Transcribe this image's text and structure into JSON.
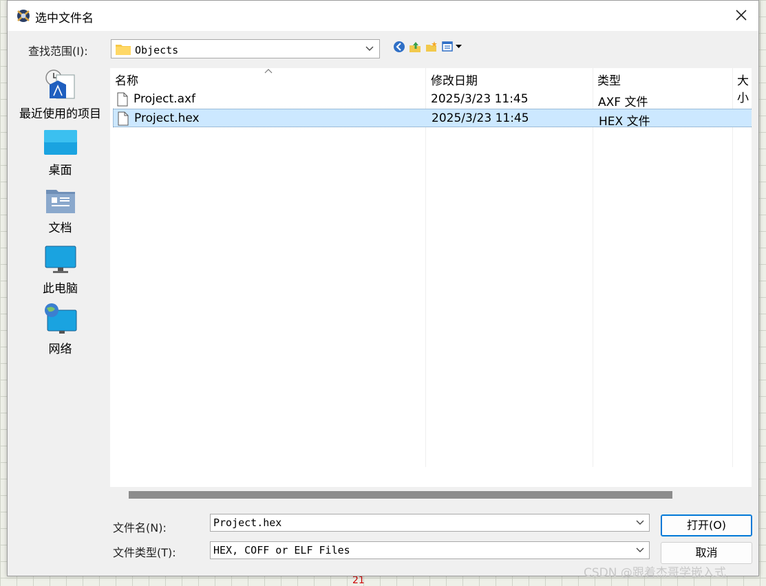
{
  "window": {
    "title": "选中文件名"
  },
  "lookin": {
    "label": "查找范围(I):",
    "value": "Objects"
  },
  "toolbar": {
    "back_icon": "back-icon",
    "up_icon": "up-folder-icon",
    "new_folder_icon": "new-folder-icon",
    "view_icon": "view-menu-icon"
  },
  "places": [
    {
      "label": "最近使用的项目",
      "icon": "recent-items-icon"
    },
    {
      "label": "桌面",
      "icon": "desktop-icon"
    },
    {
      "label": "文档",
      "icon": "documents-icon"
    },
    {
      "label": "此电脑",
      "icon": "this-pc-icon"
    },
    {
      "label": "网络",
      "icon": "network-icon"
    }
  ],
  "columns": [
    "名称",
    "修改日期",
    "类型",
    "大小"
  ],
  "files": [
    {
      "name": "Project.axf",
      "modified": "2025/3/23 11:45",
      "type": "AXF 文件",
      "selected": false
    },
    {
      "name": "Project.hex",
      "modified": "2025/3/23 11:45",
      "type": "HEX 文件",
      "selected": true
    }
  ],
  "filename": {
    "label": "文件名(N):",
    "value": "Project.hex"
  },
  "filetype": {
    "label": "文件类型(T):",
    "value": "HEX, COFF or ELF Files"
  },
  "buttons": {
    "open": "打开(O)",
    "cancel": "取消"
  },
  "colors": {
    "selection": "#cce8ff",
    "accent": "#0078d7"
  },
  "background": {
    "watermark": "CSDN @跟着杰哥学嵌入式",
    "red_number": "21"
  }
}
